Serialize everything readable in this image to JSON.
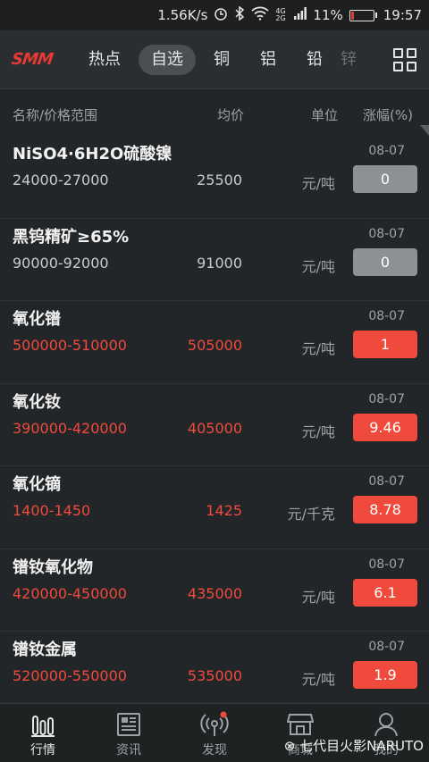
{
  "status_bar": {
    "speed": "1.56K/s",
    "signal_label": "4G 2G",
    "battery": "11%",
    "time": "19:57"
  },
  "nav": {
    "logo": "SMM",
    "tabs": [
      "热点",
      "自选",
      "铜",
      "铝",
      "铅",
      "锌"
    ],
    "active_tab": "自选"
  },
  "columns": {
    "name": "名称/价格范围",
    "avg": "均价",
    "unit": "单位",
    "change": "涨幅(%)"
  },
  "rows": [
    {
      "name": "NiSO4·6H2O硫酸镍",
      "range": "24000-27000",
      "avg": "25500",
      "unit": "元/吨",
      "date": "08-07",
      "change": "0",
      "trend": "flat"
    },
    {
      "name": "黑钨精矿≥65%",
      "range": "90000-92000",
      "avg": "91000",
      "unit": "元/吨",
      "date": "08-07",
      "change": "0",
      "trend": "flat"
    },
    {
      "name": "氧化镨",
      "range": "500000-510000",
      "avg": "505000",
      "unit": "元/吨",
      "date": "08-07",
      "change": "1",
      "trend": "up"
    },
    {
      "name": "氧化钕",
      "range": "390000-420000",
      "avg": "405000",
      "unit": "元/吨",
      "date": "08-07",
      "change": "9.46",
      "trend": "up"
    },
    {
      "name": "氧化镝",
      "range": "1400-1450",
      "avg": "1425",
      "unit": "元/千克",
      "date": "08-07",
      "change": "8.78",
      "trend": "up"
    },
    {
      "name": "镨钕氧化物",
      "range": "420000-450000",
      "avg": "435000",
      "unit": "元/吨",
      "date": "08-07",
      "change": "6.1",
      "trend": "up"
    },
    {
      "name": "镨钕金属",
      "range": "520000-550000",
      "avg": "535000",
      "unit": "元/吨",
      "date": "08-07",
      "change": "1.9",
      "trend": "up"
    }
  ],
  "bottom_tabs": [
    {
      "label": "行情",
      "icon": "chart-bars-icon",
      "active": true
    },
    {
      "label": "资讯",
      "icon": "newspaper-icon",
      "active": false
    },
    {
      "label": "发现",
      "icon": "broadcast-icon",
      "active": false,
      "badge": true
    },
    {
      "label": "商城",
      "icon": "store-icon",
      "active": false
    },
    {
      "label": "我的",
      "icon": "user-icon",
      "active": false
    }
  ],
  "watermark": "七代目火影NARUTO",
  "colors": {
    "up": "#f04a3c",
    "flat": "#8d9194",
    "background": "#232628",
    "logo": "#e53935"
  }
}
